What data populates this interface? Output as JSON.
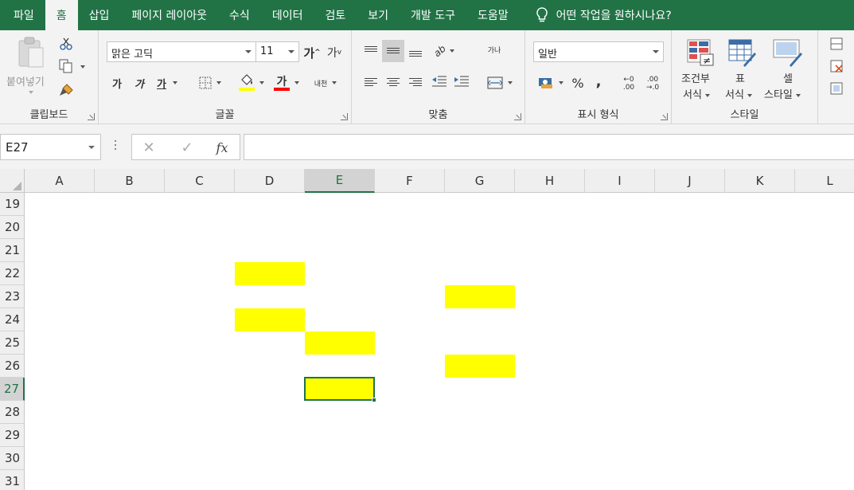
{
  "tabs": [
    {
      "label": "파일",
      "active": false
    },
    {
      "label": "홈",
      "active": true
    },
    {
      "label": "삽입",
      "active": false
    },
    {
      "label": "페이지 레이아웃",
      "active": false
    },
    {
      "label": "수식",
      "active": false
    },
    {
      "label": "데이터",
      "active": false
    },
    {
      "label": "검토",
      "active": false
    },
    {
      "label": "보기",
      "active": false
    },
    {
      "label": "개발 도구",
      "active": false
    },
    {
      "label": "도움말",
      "active": false
    }
  ],
  "tell_me": "어떤 작업을 원하시나요?",
  "clipboard": {
    "paste_label": "붙여넣기",
    "group_label": "클립보드"
  },
  "font": {
    "name": "맑은 고딕",
    "size": "11",
    "grow_glyph": "가",
    "shrink_glyph": "가",
    "bold": "가",
    "italic": "가",
    "underline": "가",
    "font_color_glyph": "가",
    "phonetic": "내천",
    "group_label": "글꼴",
    "fill_color": "#ffff00",
    "text_color": "#ff0000"
  },
  "alignment": {
    "orientation_glyph": "ab",
    "wrap_glyph": "가나",
    "group_label": "맞춤"
  },
  "number": {
    "format": "일반",
    "percent": "%",
    "comma": ",",
    "inc_decimal_top": "←0",
    "inc_decimal_bottom": ".00",
    "dec_decimal_top": ".00",
    "dec_decimal_bottom": "→.0",
    "group_label": "표시 형식"
  },
  "styles": {
    "conditional_line1": "조건부",
    "conditional_line2": "서식",
    "table_line1": "표",
    "table_line2": "서식",
    "cell_line1": "셀",
    "cell_line2": "스타일",
    "group_label": "스타일"
  },
  "formula_bar": {
    "name_box": "E27",
    "cancel": "✕",
    "enter": "✓",
    "fx": "fx",
    "value": ""
  },
  "columns": [
    "A",
    "B",
    "C",
    "D",
    "E",
    "F",
    "G",
    "H",
    "I",
    "J",
    "K",
    "L"
  ],
  "rows": [
    "19",
    "20",
    "21",
    "22",
    "23",
    "24",
    "25",
    "26",
    "27",
    "28",
    "29",
    "30",
    "31"
  ],
  "selected_column": "E",
  "selected_row": "27",
  "highlight_color": "#ffff00",
  "accent_color": "#217346",
  "highlighted_cells": [
    "D22",
    "G23",
    "D24",
    "E25",
    "G26",
    "E27"
  ]
}
